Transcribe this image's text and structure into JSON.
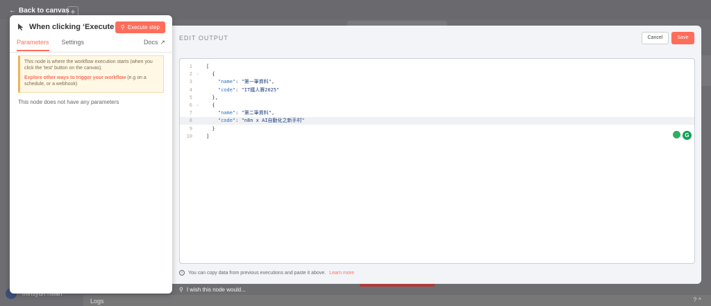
{
  "nav": {
    "back_label": "Back to canvas"
  },
  "background": {
    "plus_symbol": "+",
    "user_name": "minsyun hsiah",
    "logs_label": "Logs",
    "help_symbol": "? ^"
  },
  "left_panel": {
    "title": "When clicking ‘Execute ...",
    "execute_label": "Execute step",
    "tabs": [
      {
        "label": "Parameters"
      },
      {
        "label": "Settings"
      }
    ],
    "docs_label": "Docs",
    "info_text": "This node is where the workflow execution starts (when you click the 'test' button on the canvas).",
    "info_link": "Explore other ways to trigger your workflow",
    "info_link_suffix": " (e.g on a schedule, or a webhook)",
    "no_params": "This node does not have any parameters"
  },
  "modal": {
    "title": "EDIT OUTPUT",
    "cancel_label": "Cancel",
    "save_label": "Save",
    "footer_text": "You can copy data from previous executions and paste it above.",
    "learn_more": "Learn more",
    "ext_g_letter": "G",
    "code_lines": [
      {
        "n": "1",
        "fold": "",
        "text": "["
      },
      {
        "n": "2",
        "fold": "˅",
        "text": "  {"
      },
      {
        "n": "3",
        "fold": "",
        "text": "    \"name\": \"第一筆資料\","
      },
      {
        "n": "4",
        "fold": "",
        "text": "    \"code\": \"IT鐵人賽2025\""
      },
      {
        "n": "5",
        "fold": "",
        "text": "  },"
      },
      {
        "n": "6",
        "fold": "˅",
        "text": "  {"
      },
      {
        "n": "7",
        "fold": "",
        "text": "    \"name\": \"第二筆資料\","
      },
      {
        "n": "8",
        "fold": "",
        "text": "    \"code\": \"n8n x AI自動化之新手村\""
      },
      {
        "n": "9",
        "fold": "",
        "text": "  }"
      },
      {
        "n": "10",
        "fold": "",
        "text": "]"
      }
    ],
    "highlighted_line": 8
  },
  "wish_label": "I wish this node would..."
}
